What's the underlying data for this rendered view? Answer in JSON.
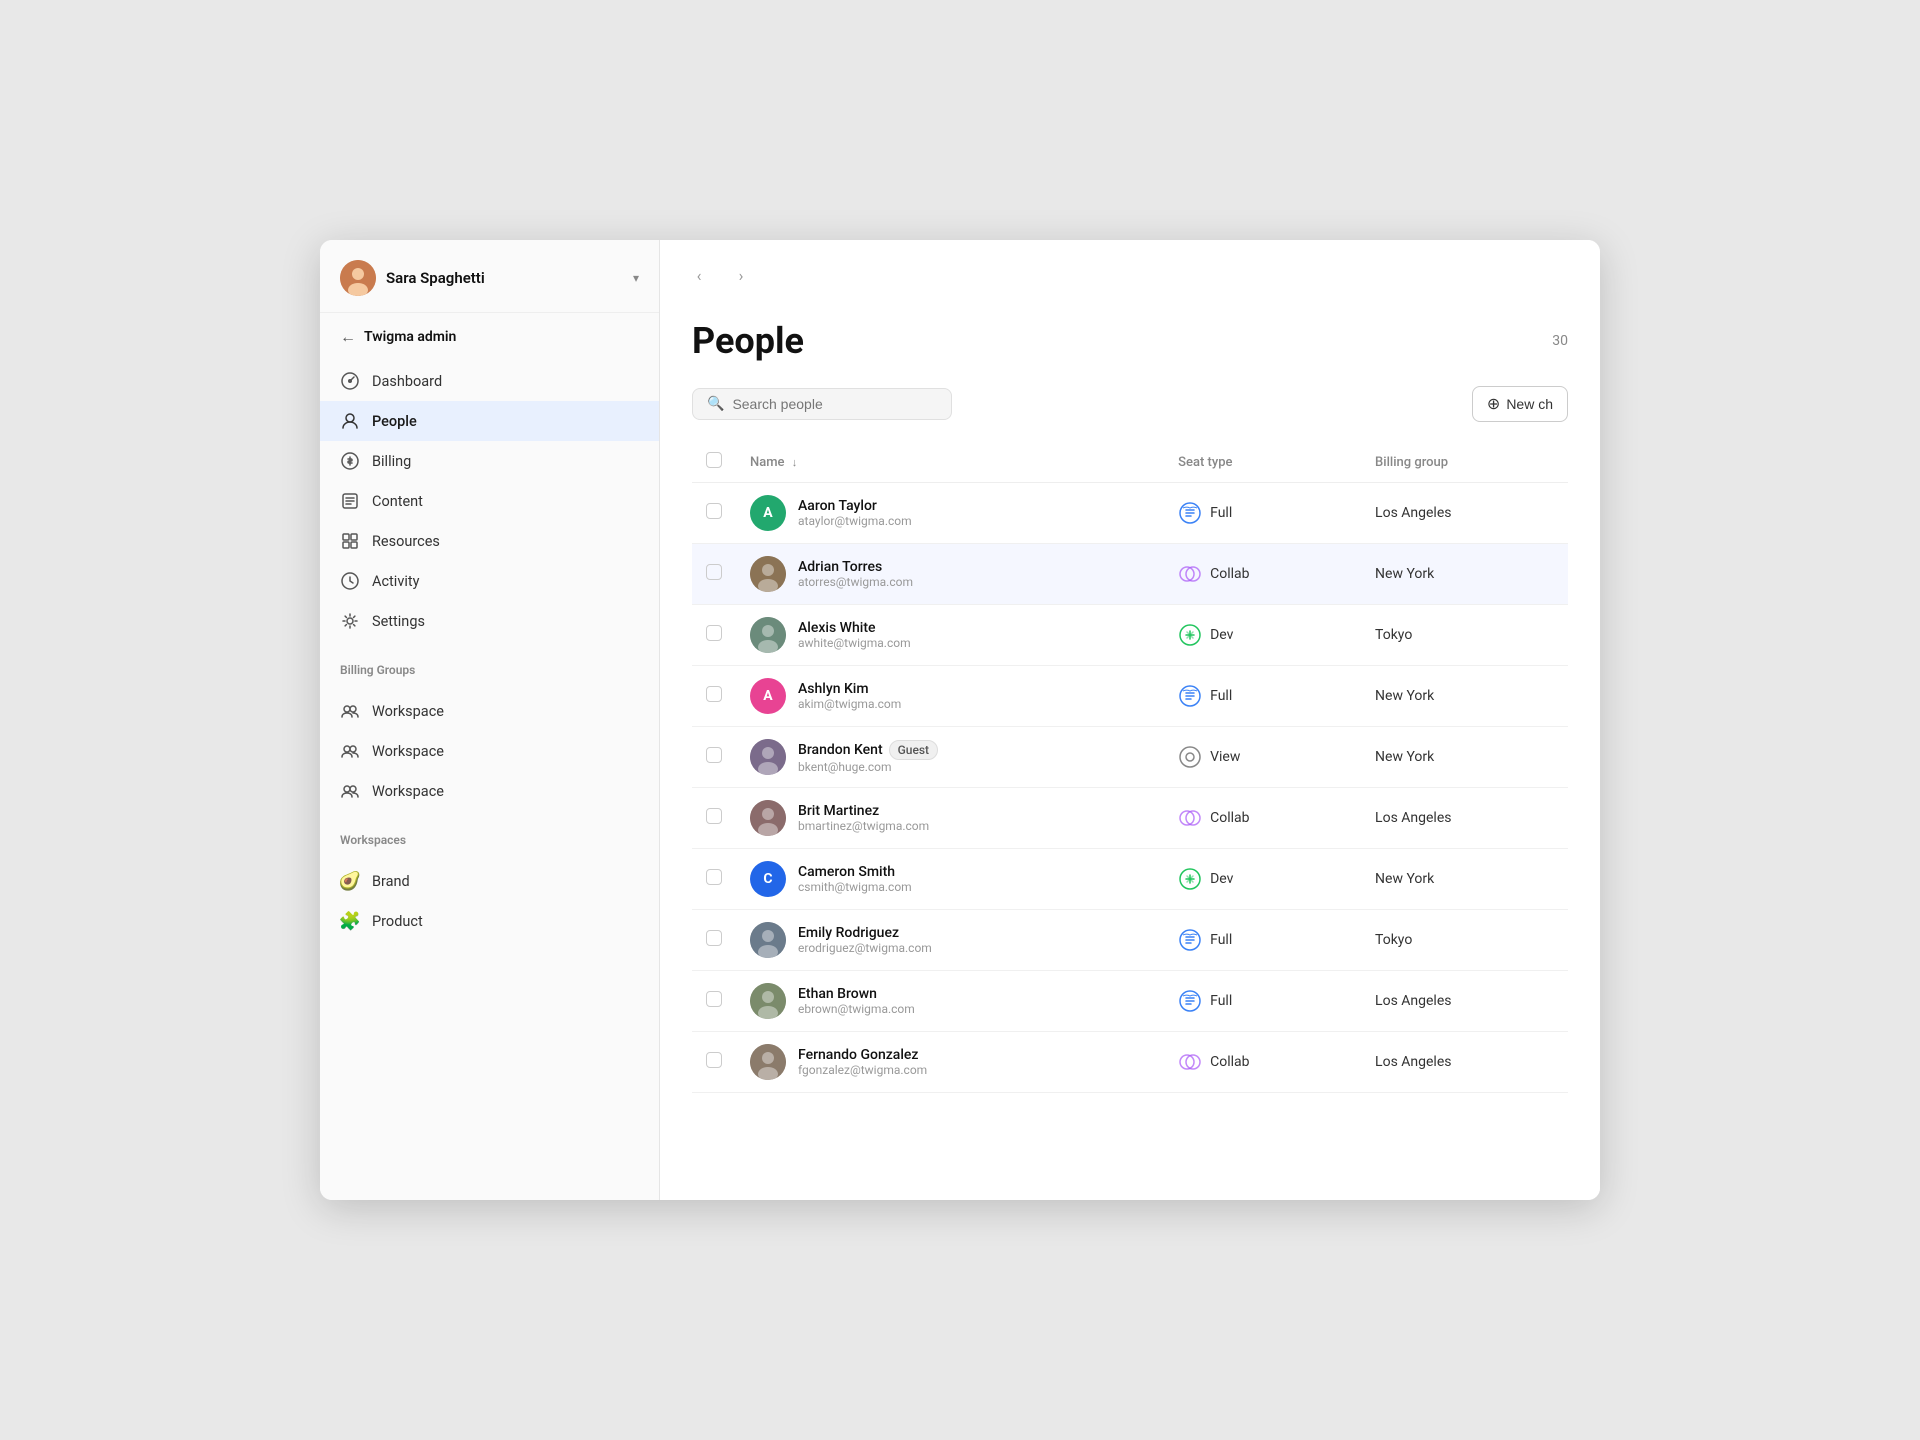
{
  "sidebar": {
    "user_name": "Sara Spaghetti",
    "back_label": "Twigma admin",
    "nav_items": [
      {
        "id": "dashboard",
        "label": "Dashboard",
        "icon": "dashboard"
      },
      {
        "id": "people",
        "label": "People",
        "icon": "person",
        "active": true
      },
      {
        "id": "billing",
        "label": "Billing",
        "icon": "billing"
      },
      {
        "id": "content",
        "label": "Content",
        "icon": "content"
      },
      {
        "id": "resources",
        "label": "Resources",
        "icon": "resources"
      },
      {
        "id": "activity",
        "label": "Activity",
        "icon": "activity"
      },
      {
        "id": "settings",
        "label": "Settings",
        "icon": "settings"
      }
    ],
    "billing_groups_label": "Billing Groups",
    "billing_groups": [
      {
        "label": "Workspace"
      },
      {
        "label": "Workspace"
      },
      {
        "label": "Workspace"
      }
    ],
    "workspaces_label": "Workspaces",
    "workspaces": [
      {
        "label": "Brand",
        "icon": "avocado"
      },
      {
        "label": "Product",
        "icon": "puzzle"
      }
    ]
  },
  "main": {
    "page_title": "People",
    "count": "30",
    "search_placeholder": "Search people",
    "new_button_label": "New ch",
    "table": {
      "columns": [
        {
          "id": "name",
          "label": "Name",
          "sort": true
        },
        {
          "id": "seat_type",
          "label": "Seat type"
        },
        {
          "id": "billing_group",
          "label": "Billing group"
        }
      ],
      "rows": [
        {
          "id": 1,
          "name": "Aaron Taylor",
          "email": "ataylor@twigma.com",
          "seat": "Full",
          "seat_icon": "full",
          "billing": "Los Angeles",
          "avatar_color": "#22a86e",
          "avatar_letter": "A",
          "is_photo": false,
          "guest": false
        },
        {
          "id": 2,
          "name": "Adrian Torres",
          "email": "atorres@twigma.com",
          "seat": "Collab",
          "seat_icon": "collab",
          "billing": "New York",
          "avatar_color": "#aaa",
          "avatar_letter": "",
          "is_photo": true,
          "photo_seed": "adrian",
          "guest": false,
          "highlighted": true
        },
        {
          "id": 3,
          "name": "Alexis White",
          "email": "awhite@twigma.com",
          "seat": "Dev",
          "seat_icon": "dev",
          "billing": "Tokyo",
          "avatar_color": "#aaa",
          "avatar_letter": "",
          "is_photo": true,
          "photo_seed": "alexis",
          "guest": false
        },
        {
          "id": 4,
          "name": "Ashlyn Kim",
          "email": "akim@twigma.com",
          "seat": "Full",
          "seat_icon": "full",
          "billing": "New York",
          "avatar_color": "#e84393",
          "avatar_letter": "A",
          "is_photo": false,
          "guest": false
        },
        {
          "id": 5,
          "name": "Brandon Kent",
          "email": "bkent@huge.com",
          "seat": "View",
          "seat_icon": "view",
          "billing": "New York",
          "avatar_color": "#aaa",
          "avatar_letter": "",
          "is_photo": true,
          "photo_seed": "brandon",
          "guest": true
        },
        {
          "id": 6,
          "name": "Brit Martinez",
          "email": "bmartinez@twigma.com",
          "seat": "Collab",
          "seat_icon": "collab",
          "billing": "Los Angeles",
          "avatar_color": "#aaa",
          "avatar_letter": "",
          "is_photo": true,
          "photo_seed": "brit",
          "guest": false
        },
        {
          "id": 7,
          "name": "Cameron Smith",
          "email": "csmith@twigma.com",
          "seat": "Dev",
          "seat_icon": "dev",
          "billing": "New York",
          "avatar_color": "#2266e8",
          "avatar_letter": "C",
          "is_photo": false,
          "guest": false
        },
        {
          "id": 8,
          "name": "Emily Rodriguez",
          "email": "erodriguez@twigma.com",
          "seat": "Full",
          "seat_icon": "full",
          "billing": "Tokyo",
          "avatar_color": "#aaa",
          "avatar_letter": "",
          "is_photo": true,
          "photo_seed": "emily",
          "guest": false
        },
        {
          "id": 9,
          "name": "Ethan Brown",
          "email": "ebrown@twigma.com",
          "seat": "Full",
          "seat_icon": "full",
          "billing": "Los Angeles",
          "avatar_color": "#aaa",
          "avatar_letter": "",
          "is_photo": true,
          "photo_seed": "ethan",
          "guest": false
        },
        {
          "id": 10,
          "name": "Fernando Gonzalez",
          "email": "fgonzalez@twigma.com",
          "seat": "Collab",
          "seat_icon": "collab",
          "billing": "Los Angeles",
          "avatar_color": "#aaa",
          "avatar_letter": "",
          "is_photo": true,
          "photo_seed": "fernando",
          "guest": false
        }
      ]
    }
  }
}
